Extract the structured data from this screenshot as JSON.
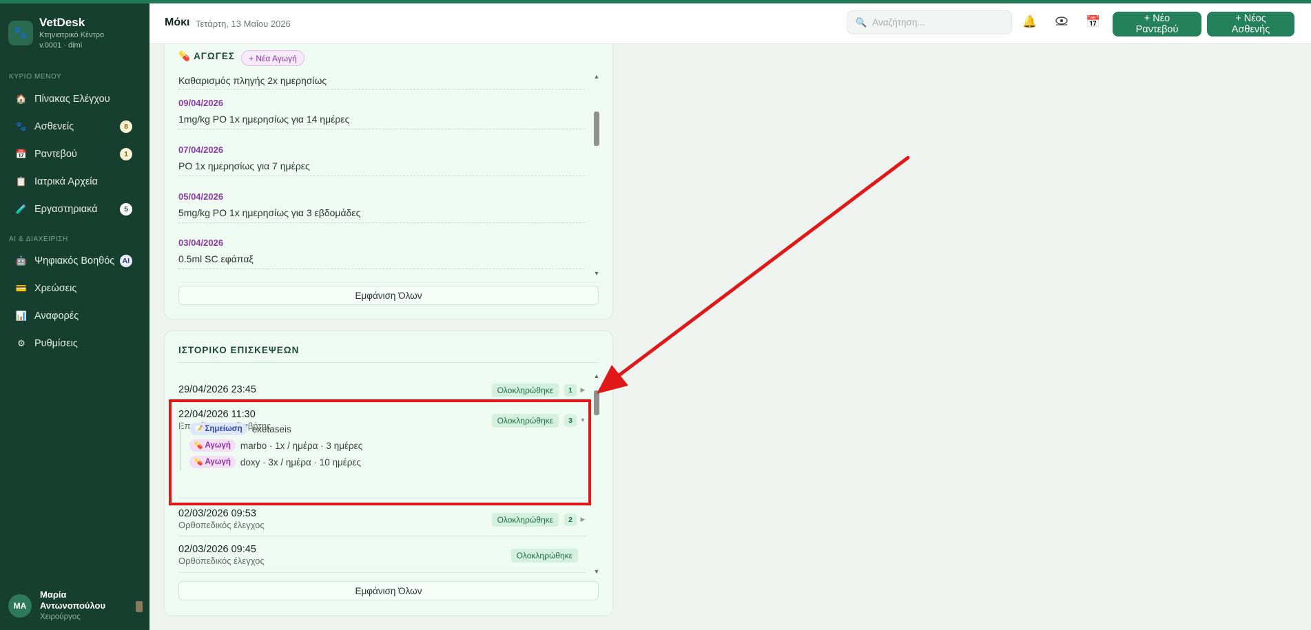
{
  "sidebar": {
    "brand": {
      "name": "VetDesk",
      "subtitle": "Κτηνιατρικό Κέντρο",
      "version": "v.0001 · dimi",
      "logo_icon": "paw-icon"
    },
    "main_section": "ΚΥΡΙΟ ΜΕΝΟΥ",
    "main_items": [
      {
        "label": "Πίνακας Ελέγχου",
        "icon": "home-icon",
        "badge": ""
      },
      {
        "label": "Ασθενείς",
        "icon": "paw-icon",
        "badge": "8"
      },
      {
        "label": "Ραντεβού",
        "icon": "calendar-icon",
        "badge": "1"
      },
      {
        "label": "Ιατρικά Αρχεία",
        "icon": "clipboard-icon",
        "badge": ""
      },
      {
        "label": "Εργαστηριακά",
        "icon": "test-tube-icon",
        "badge": "5"
      }
    ],
    "ai_section": "AI & ΔΙΑΧΕΙΡΙΣΗ",
    "ai_items": [
      {
        "label": "Ψηφιακός Βοηθός",
        "icon": "robot-icon",
        "badge": "AI"
      },
      {
        "label": "Χρεώσεις",
        "icon": "credit-card-icon",
        "badge": ""
      },
      {
        "label": "Αναφορές",
        "icon": "bar-chart-icon",
        "badge": ""
      },
      {
        "label": "Ρυθμίσεις",
        "icon": "gear-icon",
        "badge": ""
      }
    ],
    "user": {
      "initials": "MA",
      "name_line1": "Μαρία",
      "name_line2": "Αντωνοπούλου",
      "role": "Χειρούργος"
    }
  },
  "header": {
    "title": "Μόκι",
    "date": "Τετάρτη, 13 Μαΐου 2026",
    "search_placeholder": "Αναζήτηση...",
    "new_appointment": "+ Νέο Ραντεβού",
    "new_patient": "+ Νέος Ασθενής"
  },
  "treatments": {
    "title": "ΑΓΩΓΕΣ",
    "new_label": "+ Νέα Αγωγή",
    "items": [
      {
        "date": "",
        "desc": "Καθαρισμός πληγής 2x ημερησίως"
      },
      {
        "date": "09/04/2026",
        "desc": "1mg/kg PO 1x ημερησίως για 14 ημέρες"
      },
      {
        "date": "07/04/2026",
        "desc": "PO 1x ημερησίως για 7 ημέρες"
      },
      {
        "date": "05/04/2026",
        "desc": "5mg/kg PO 1x ημερησίως για 3 εβδομάδες"
      },
      {
        "date": "03/04/2026",
        "desc": "0.5ml SC εφάπαξ"
      }
    ],
    "show_all": "Εμφάνιση Όλων"
  },
  "history": {
    "title": "ΙΣΤΟΡΙΚΟ ΕΠΙΣΚΕΨΕΩΝ",
    "visits": [
      {
        "datetime": "29/04/2026 23:45",
        "reason": "",
        "status": "Ολοκληρώθηκε",
        "count": "1",
        "expanded": false
      },
      {
        "datetime": "22/04/2026 11:30",
        "reason": "Επανέλεγχος: διαβήτης",
        "status": "Ολοκληρώθηκε",
        "count": "3",
        "expanded": true
      },
      {
        "datetime": "02/03/2026 09:53",
        "reason": "Ορθοπεδικός έλεγχος",
        "status": "Ολοκληρώθηκε",
        "count": "2",
        "expanded": false
      },
      {
        "datetime": "02/03/2026 09:45",
        "reason": "Ορθοπεδικός έλεγχος",
        "status": "Ολοκληρώθηκε",
        "count": "",
        "expanded": false
      }
    ],
    "details": [
      {
        "tag": "Σημείωση",
        "type": "note",
        "text": "exetaseis"
      },
      {
        "tag": "Αγωγή",
        "type": "treatment",
        "text": "marbo · 1x / ημέρα · 3 ημέρες"
      },
      {
        "tag": "Αγωγή",
        "type": "treatment",
        "text": "doxy · 3x / ημέρα · 10 ημέρες"
      }
    ],
    "show_all": "Εμφάνιση Όλων"
  },
  "colors": {
    "sidebar": "#173f30",
    "accent": "#23815b",
    "annotation": "#e01818",
    "treatment_date": "#8a3aa8"
  }
}
